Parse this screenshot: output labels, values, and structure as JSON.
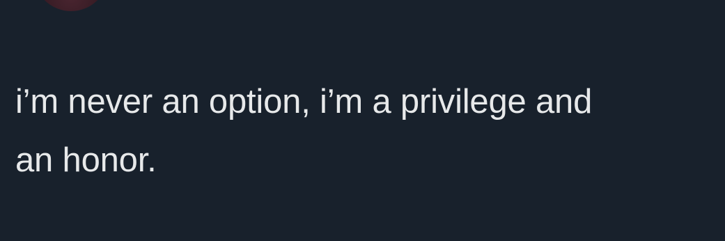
{
  "tweet": {
    "lines": [
      "i’m never an option, i’m a privilege and",
      "an honor."
    ]
  },
  "colors": {
    "background": "#18212c",
    "text": "#e7e9ea"
  }
}
